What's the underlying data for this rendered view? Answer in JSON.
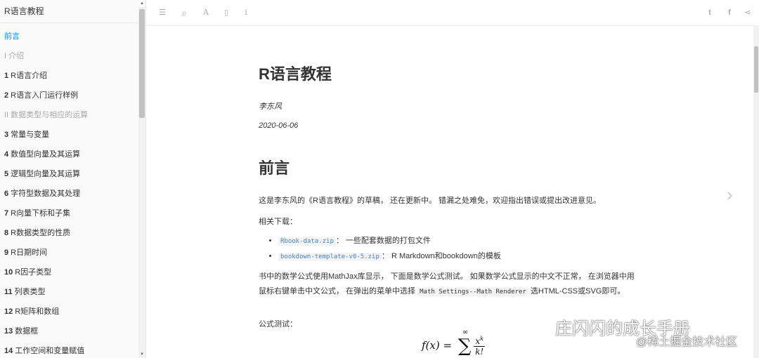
{
  "sidebar": {
    "book_title": "R语言教程",
    "items": [
      {
        "num": "",
        "label": "前言",
        "kind": "active"
      },
      {
        "num": "",
        "label": "I 介绍",
        "kind": "part"
      },
      {
        "num": "1",
        "label": "R语言介绍",
        "kind": "chapter"
      },
      {
        "num": "2",
        "label": "R语言入门运行样例",
        "kind": "chapter"
      },
      {
        "num": "",
        "label": "II 数据类型与相应的运算",
        "kind": "part"
      },
      {
        "num": "3",
        "label": "常量与变量",
        "kind": "chapter"
      },
      {
        "num": "4",
        "label": "数值型向量及其运算",
        "kind": "chapter"
      },
      {
        "num": "5",
        "label": "逻辑型向量及其运算",
        "kind": "chapter"
      },
      {
        "num": "6",
        "label": "字符型数据及其处理",
        "kind": "chapter"
      },
      {
        "num": "7",
        "label": "R向量下标和子集",
        "kind": "chapter"
      },
      {
        "num": "8",
        "label": "R数据类型的性质",
        "kind": "chapter"
      },
      {
        "num": "9",
        "label": "R日期时间",
        "kind": "chapter"
      },
      {
        "num": "10",
        "label": "R因子类型",
        "kind": "chapter"
      },
      {
        "num": "11",
        "label": "列表类型",
        "kind": "chapter"
      },
      {
        "num": "12",
        "label": "R矩阵和数组",
        "kind": "chapter"
      },
      {
        "num": "13",
        "label": "数据框",
        "kind": "chapter"
      },
      {
        "num": "14",
        "label": "工作空间和变量赋值",
        "kind": "chapter"
      }
    ]
  },
  "toolbar": {
    "icons": [
      "menu-icon",
      "search-icon",
      "font-icon",
      "edit-icon",
      "info-icon",
      "twitter-icon",
      "facebook-icon",
      "share-icon"
    ],
    "glyphs": {
      "menu": "☰",
      "search": "⌕",
      "font": "A",
      "edit": "▯",
      "info": "i",
      "twitter": "t",
      "facebook": "f",
      "share": "⋖"
    }
  },
  "main": {
    "title": "R语言教程",
    "author": "李东风",
    "date": "2020-06-06",
    "section_title": "前言",
    "para1": "这是李东风的《R语言教程》的草稿， 还在更新中。 错漏之处难免，欢迎指出错误或提出改进意见。",
    "para2": "相关下载：",
    "downloads": [
      {
        "link": "Rbook-data.zip",
        "desc": "： 一些配套数据的打包文件"
      },
      {
        "link": "bookdown-template-v0-5.zip",
        "desc": "： R Markdown和bookdown的模板"
      }
    ],
    "para3_a": "书中的数学公式使用MathJax库显示， 下面是数学公式测试。 如果数学公式显示的中文不正常， 在浏览器中用鼠标右键单击中文公式， 在弹出的菜单中选择 ",
    "para3_code": "Math Settings--Math Renderer",
    "para3_b": " 选HTML-CSS或SVG即可。",
    "para4": "公式测试：",
    "formula_lhs": "f(x) = ",
    "formula_sum": "∑",
    "formula_sup": "∞",
    "formula_num": "x",
    "formula_exp": "k",
    "formula_den": "k!"
  },
  "nav": {
    "next_glyph": "›"
  },
  "watermark": {
    "line1": "庄闪闪的成长手册",
    "line2": "@稀土掘金技术社区"
  }
}
